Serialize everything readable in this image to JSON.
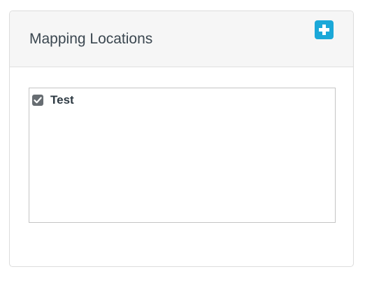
{
  "panel": {
    "title": "Mapping Locations",
    "add_button": {
      "icon": "plus-icon",
      "color": "#1ba8d8"
    }
  },
  "locations": {
    "items": [
      {
        "label": "Test",
        "checked": true
      }
    ]
  }
}
